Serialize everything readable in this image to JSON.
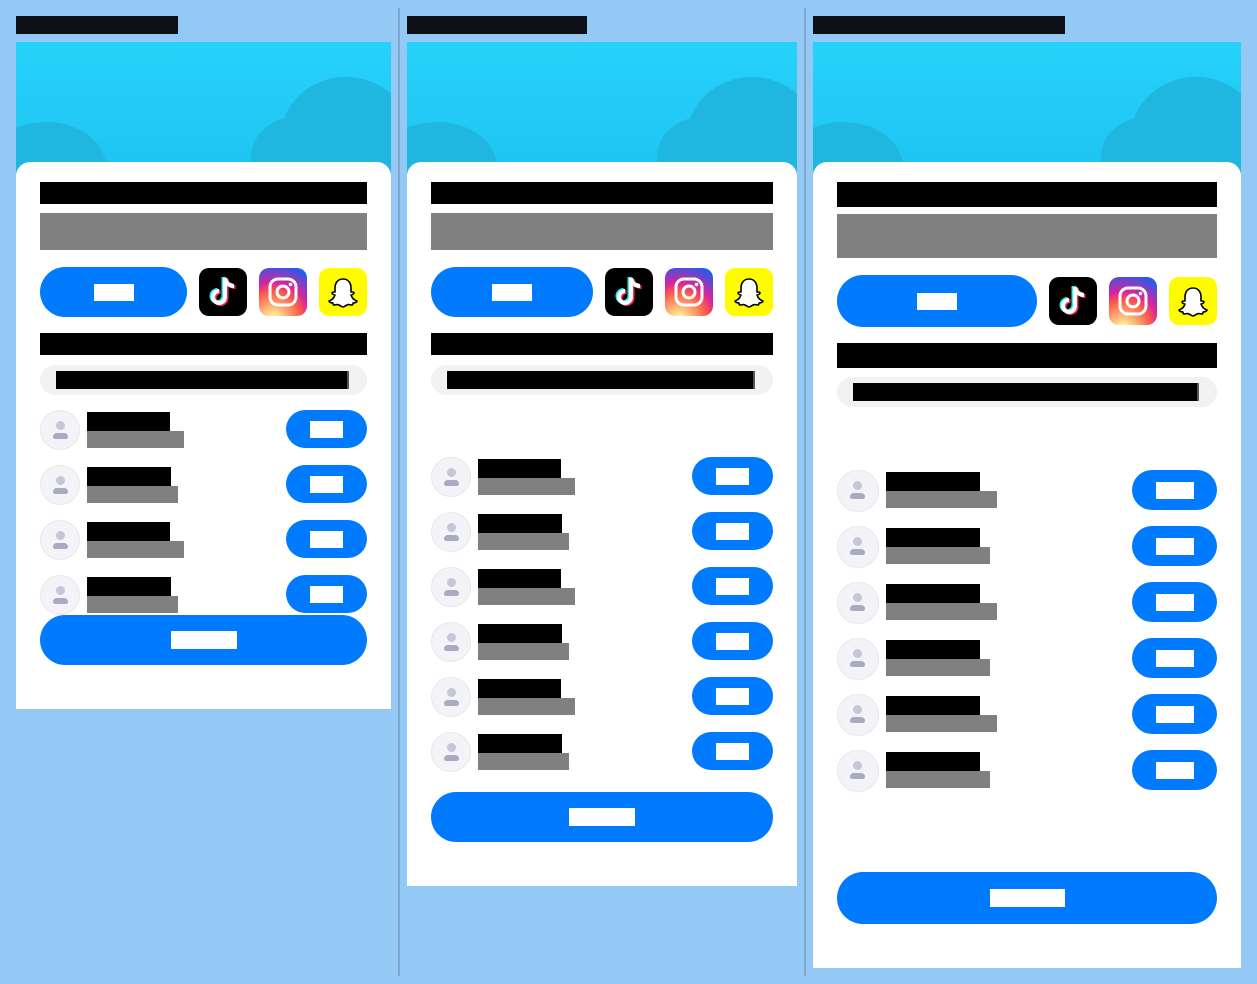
{
  "variants": [
    {
      "id": "a",
      "title": "",
      "heading": "",
      "subtitle": "",
      "share_button_label": "",
      "social_icons": [
        "tiktok-icon",
        "instagram-icon",
        "snapchat-icon"
      ],
      "section_heading": "",
      "search_value": "",
      "follow_label": "",
      "rows": [
        {
          "name": "",
          "handle": ""
        },
        {
          "name": "",
          "handle": ""
        },
        {
          "name": "",
          "handle": ""
        },
        {
          "name": "",
          "handle": ""
        }
      ],
      "cta_label": ""
    },
    {
      "id": "b",
      "title": "",
      "heading": "",
      "subtitle": "",
      "share_button_label": "",
      "social_icons": [
        "tiktok-icon",
        "instagram-icon",
        "snapchat-icon"
      ],
      "section_heading": "",
      "search_value": "",
      "follow_label": "",
      "rows": [
        {
          "name": "",
          "handle": ""
        },
        {
          "name": "",
          "handle": ""
        },
        {
          "name": "",
          "handle": ""
        },
        {
          "name": "",
          "handle": ""
        },
        {
          "name": "",
          "handle": ""
        },
        {
          "name": "",
          "handle": ""
        }
      ],
      "cta_label": ""
    },
    {
      "id": "c",
      "title": "",
      "heading": "",
      "subtitle": "",
      "share_button_label": "",
      "social_icons": [
        "tiktok-icon",
        "instagram-icon",
        "snapchat-icon"
      ],
      "section_heading": "",
      "search_value": "",
      "follow_label": "",
      "rows": [
        {
          "name": "",
          "handle": ""
        },
        {
          "name": "",
          "handle": ""
        },
        {
          "name": "",
          "handle": ""
        },
        {
          "name": "",
          "handle": ""
        },
        {
          "name": "",
          "handle": ""
        },
        {
          "name": "",
          "handle": ""
        }
      ],
      "cta_label": ""
    }
  ],
  "colors": {
    "page_background": "#94c9f5",
    "banner": "#26d2fb",
    "accent": "#007bff",
    "card": "#ffffff",
    "snapchat": "#fffc00",
    "tiktok": "#000000"
  }
}
